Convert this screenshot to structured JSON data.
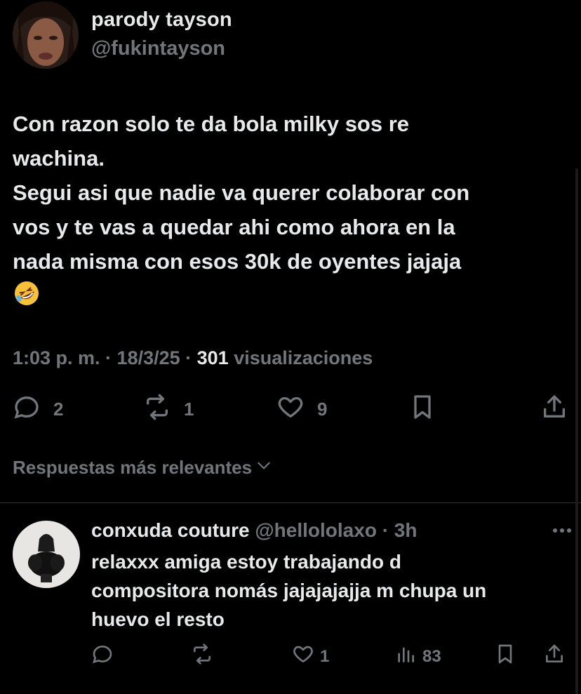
{
  "tweet": {
    "display_name": "parody tayson",
    "handle": "@fukintayson",
    "text": "Con razon solo te da bola milky sos re\nwachina.\nSegui asi que nadie va querer colaborar con\nvos y te vas a quedar ahi como ahora en la\nnada misma con esos 30k de oyentes jajaja\n",
    "emoji_icon": "rolling-on-floor-laughing-emoji",
    "time": "1:03 p. m.",
    "sep1": " · ",
    "date": "18/3/25",
    "sep2": " · ",
    "views_count": "301",
    "views_label": " visualizaciones",
    "stats": {
      "replies": "2",
      "retweets": "1",
      "likes": "9"
    }
  },
  "replies_sort_label": "Respuestas más relevantes",
  "reply": {
    "display_name": "conxuda couture",
    "handle_time": " @hellololaxo · 3h",
    "text": "relaxxx amiga estoy trabajando d\ncompositora nomás jajajajajja m chupa un\nhuevo el resto",
    "stats": {
      "likes": "1",
      "views": "83"
    }
  },
  "colors": {
    "background": "#000000",
    "text": "#e7e9ea",
    "muted": "#71767b",
    "divider": "#2f3336"
  }
}
